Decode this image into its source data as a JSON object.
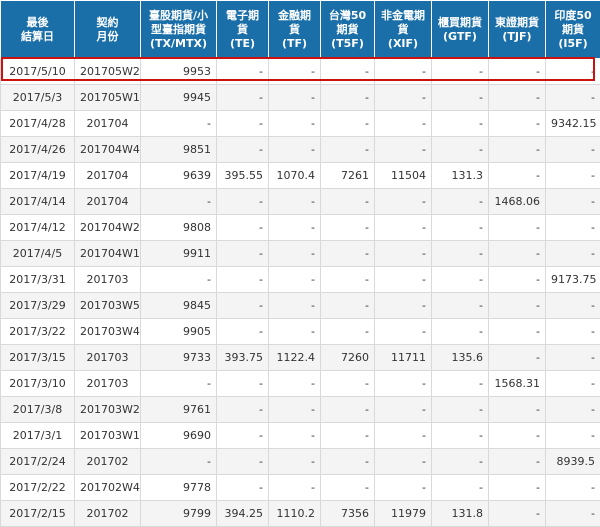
{
  "headers": [
    [
      "最後",
      "結算日"
    ],
    [
      "契約",
      "月份"
    ],
    [
      "臺股期貨/小",
      "型臺指期貨",
      "(TX/MTX)"
    ],
    [
      "電子期",
      "貨",
      "(TE)"
    ],
    [
      "金融期",
      "貨",
      "(TF)"
    ],
    [
      "台灣50",
      "期貨",
      "(T5F)"
    ],
    [
      "非金電期",
      "貨",
      "(XIF)"
    ],
    [
      "櫃買期貨",
      "(GTF)"
    ],
    [
      "東證期貨",
      "(TJF)"
    ],
    [
      "印度50",
      "期貨",
      "(I5F)"
    ]
  ],
  "rows": [
    [
      "2017/5/10",
      "201705W2",
      "9953",
      "-",
      "-",
      "-",
      "-",
      "-",
      "-",
      "-"
    ],
    [
      "2017/5/3",
      "201705W1",
      "9945",
      "-",
      "-",
      "-",
      "-",
      "-",
      "-",
      "-"
    ],
    [
      "2017/4/28",
      "201704",
      "-",
      "-",
      "-",
      "-",
      "-",
      "-",
      "-",
      "9342.15"
    ],
    [
      "2017/4/26",
      "201704W4",
      "9851",
      "-",
      "-",
      "-",
      "-",
      "-",
      "-",
      "-"
    ],
    [
      "2017/4/19",
      "201704",
      "9639",
      "395.55",
      "1070.4",
      "7261",
      "11504",
      "131.3",
      "-",
      "-"
    ],
    [
      "2017/4/14",
      "201704",
      "-",
      "-",
      "-",
      "-",
      "-",
      "-",
      "1468.06",
      "-"
    ],
    [
      "2017/4/12",
      "201704W2",
      "9808",
      "-",
      "-",
      "-",
      "-",
      "-",
      "-",
      "-"
    ],
    [
      "2017/4/5",
      "201704W1",
      "9911",
      "-",
      "-",
      "-",
      "-",
      "-",
      "-",
      "-"
    ],
    [
      "2017/3/31",
      "201703",
      "-",
      "-",
      "-",
      "-",
      "-",
      "-",
      "-",
      "9173.75"
    ],
    [
      "2017/3/29",
      "201703W5",
      "9845",
      "-",
      "-",
      "-",
      "-",
      "-",
      "-",
      "-"
    ],
    [
      "2017/3/22",
      "201703W4",
      "9905",
      "-",
      "-",
      "-",
      "-",
      "-",
      "-",
      "-"
    ],
    [
      "2017/3/15",
      "201703",
      "9733",
      "393.75",
      "1122.4",
      "7260",
      "11711",
      "135.6",
      "-",
      "-"
    ],
    [
      "2017/3/10",
      "201703",
      "-",
      "-",
      "-",
      "-",
      "-",
      "-",
      "1568.31",
      "-"
    ],
    [
      "2017/3/8",
      "201703W2",
      "9761",
      "-",
      "-",
      "-",
      "-",
      "-",
      "-",
      "-"
    ],
    [
      "2017/3/1",
      "201703W1",
      "9690",
      "-",
      "-",
      "-",
      "-",
      "-",
      "-",
      "-"
    ],
    [
      "2017/2/24",
      "201702",
      "-",
      "-",
      "-",
      "-",
      "-",
      "-",
      "-",
      "8939.5"
    ],
    [
      "2017/2/22",
      "201702W4",
      "9778",
      "-",
      "-",
      "-",
      "-",
      "-",
      "-",
      "-"
    ],
    [
      "2017/2/15",
      "201702",
      "9799",
      "394.25",
      "1110.2",
      "7356",
      "11979",
      "131.8",
      "-",
      "-"
    ]
  ],
  "colors": {
    "header_bg": "#1b6fa8",
    "highlight": "#cc1111"
  }
}
